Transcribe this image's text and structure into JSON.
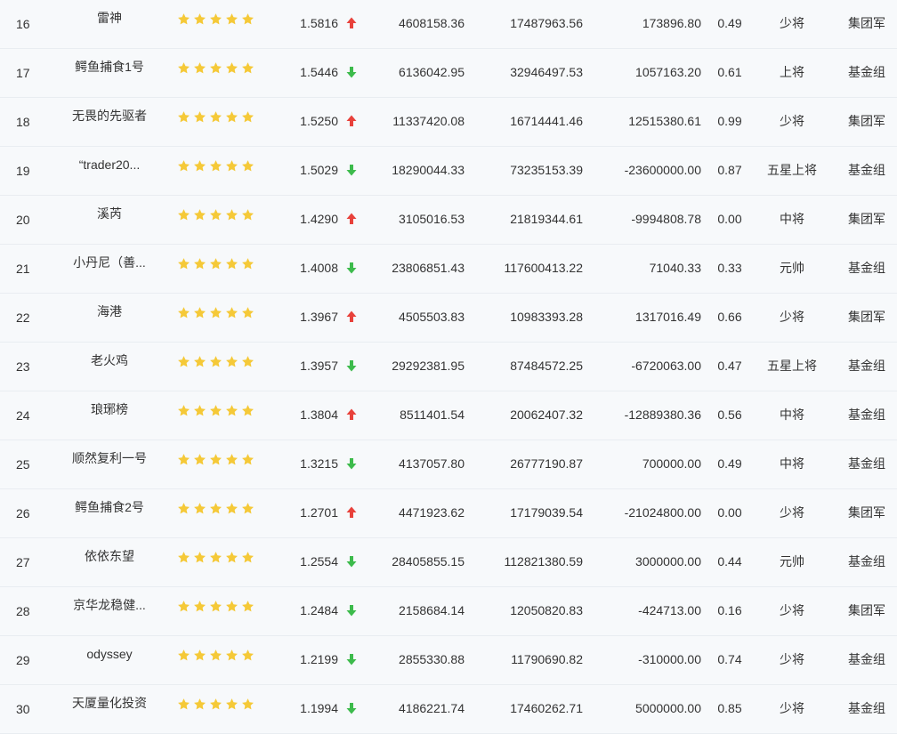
{
  "colors": {
    "up": "#e8413b",
    "down": "#3dbb4c",
    "star": "#f5c938"
  },
  "star_count": 5,
  "rows": [
    {
      "rank": "16",
      "name": "雷神",
      "nav": "1.5816",
      "trend": "up",
      "col_a": "4608158.36",
      "col_b": "17487963.56",
      "col_c": "173896.80",
      "ratio": "0.49",
      "title": "少将",
      "group": "集团军"
    },
    {
      "rank": "17",
      "name": "鳄鱼捕食1号",
      "nav": "1.5446",
      "trend": "down",
      "col_a": "6136042.95",
      "col_b": "32946497.53",
      "col_c": "1057163.20",
      "ratio": "0.61",
      "title": "上将",
      "group": "基金组"
    },
    {
      "rank": "18",
      "name": "无畏的先驱者",
      "nav": "1.5250",
      "trend": "up",
      "col_a": "11337420.08",
      "col_b": "16714441.46",
      "col_c": "12515380.61",
      "ratio": "0.99",
      "title": "少将",
      "group": "集团军"
    },
    {
      "rank": "19",
      "name": "“trader20...",
      "nav": "1.5029",
      "trend": "down",
      "col_a": "18290044.33",
      "col_b": "73235153.39",
      "col_c": "-23600000.00",
      "ratio": "0.87",
      "title": "五星上将",
      "group": "基金组"
    },
    {
      "rank": "20",
      "name": "溪芮",
      "nav": "1.4290",
      "trend": "up",
      "col_a": "3105016.53",
      "col_b": "21819344.61",
      "col_c": "-9994808.78",
      "ratio": "0.00",
      "title": "中将",
      "group": "集团军"
    },
    {
      "rank": "21",
      "name": "小丹尼（善...",
      "nav": "1.4008",
      "trend": "down",
      "col_a": "23806851.43",
      "col_b": "117600413.22",
      "col_c": "71040.33",
      "ratio": "0.33",
      "title": "元帅",
      "group": "基金组"
    },
    {
      "rank": "22",
      "name": "海港",
      "nav": "1.3967",
      "trend": "up",
      "col_a": "4505503.83",
      "col_b": "10983393.28",
      "col_c": "1317016.49",
      "ratio": "0.66",
      "title": "少将",
      "group": "集团军"
    },
    {
      "rank": "23",
      "name": "老火鸡",
      "nav": "1.3957",
      "trend": "down",
      "col_a": "29292381.95",
      "col_b": "87484572.25",
      "col_c": "-6720063.00",
      "ratio": "0.47",
      "title": "五星上将",
      "group": "基金组"
    },
    {
      "rank": "24",
      "name": "琅琊榜",
      "nav": "1.3804",
      "trend": "up",
      "col_a": "8511401.54",
      "col_b": "20062407.32",
      "col_c": "-12889380.36",
      "ratio": "0.56",
      "title": "中将",
      "group": "基金组"
    },
    {
      "rank": "25",
      "name": "顺然复利一号",
      "nav": "1.3215",
      "trend": "down",
      "col_a": "4137057.80",
      "col_b": "26777190.87",
      "col_c": "700000.00",
      "ratio": "0.49",
      "title": "中将",
      "group": "基金组"
    },
    {
      "rank": "26",
      "name": "鳄鱼捕食2号",
      "nav": "1.2701",
      "trend": "up",
      "col_a": "4471923.62",
      "col_b": "17179039.54",
      "col_c": "-21024800.00",
      "ratio": "0.00",
      "title": "少将",
      "group": "集团军"
    },
    {
      "rank": "27",
      "name": "依依东望",
      "nav": "1.2554",
      "trend": "down",
      "col_a": "28405855.15",
      "col_b": "112821380.59",
      "col_c": "3000000.00",
      "ratio": "0.44",
      "title": "元帅",
      "group": "基金组"
    },
    {
      "rank": "28",
      "name": "京华龙稳健...",
      "nav": "1.2484",
      "trend": "down",
      "col_a": "2158684.14",
      "col_b": "12050820.83",
      "col_c": "-424713.00",
      "ratio": "0.16",
      "title": "少将",
      "group": "集团军"
    },
    {
      "rank": "29",
      "name": "odyssey",
      "nav": "1.2199",
      "trend": "down",
      "col_a": "2855330.88",
      "col_b": "11790690.82",
      "col_c": "-310000.00",
      "ratio": "0.74",
      "title": "少将",
      "group": "基金组"
    },
    {
      "rank": "30",
      "name": "天厦量化投资",
      "nav": "1.1994",
      "trend": "down",
      "col_a": "4186221.74",
      "col_b": "17460262.71",
      "col_c": "5000000.00",
      "ratio": "0.85",
      "title": "少将",
      "group": "基金组"
    }
  ]
}
